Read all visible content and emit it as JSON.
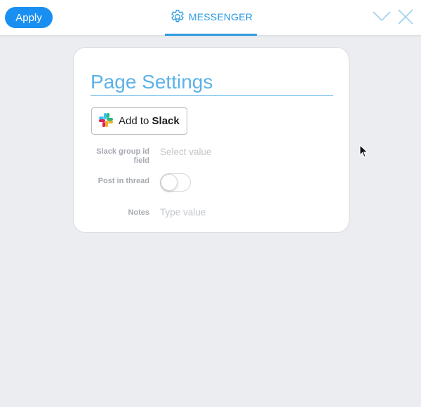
{
  "toolbar": {
    "apply_label": "Apply",
    "tab_label": "MESSENGER",
    "tab_icon": "gear-icon",
    "collapse_icon": "chevron-down-icon",
    "close_icon": "close-icon"
  },
  "panel": {
    "title": "Page Settings",
    "slack_button": {
      "prefix": "Add to",
      "brand": "Slack"
    },
    "fields": [
      {
        "label": "Slack group id field",
        "placeholder": "Select value",
        "type": "select"
      },
      {
        "label": "Post in thread",
        "type": "toggle",
        "value": false
      },
      {
        "label": "Notes",
        "placeholder": "Type value",
        "type": "text"
      }
    ]
  },
  "colors": {
    "accent": "#2e9be0",
    "apply_button": "#1a8ff2",
    "background": "#ebedf0",
    "label": "#a7abb1",
    "placeholder": "#c2c5ca"
  }
}
